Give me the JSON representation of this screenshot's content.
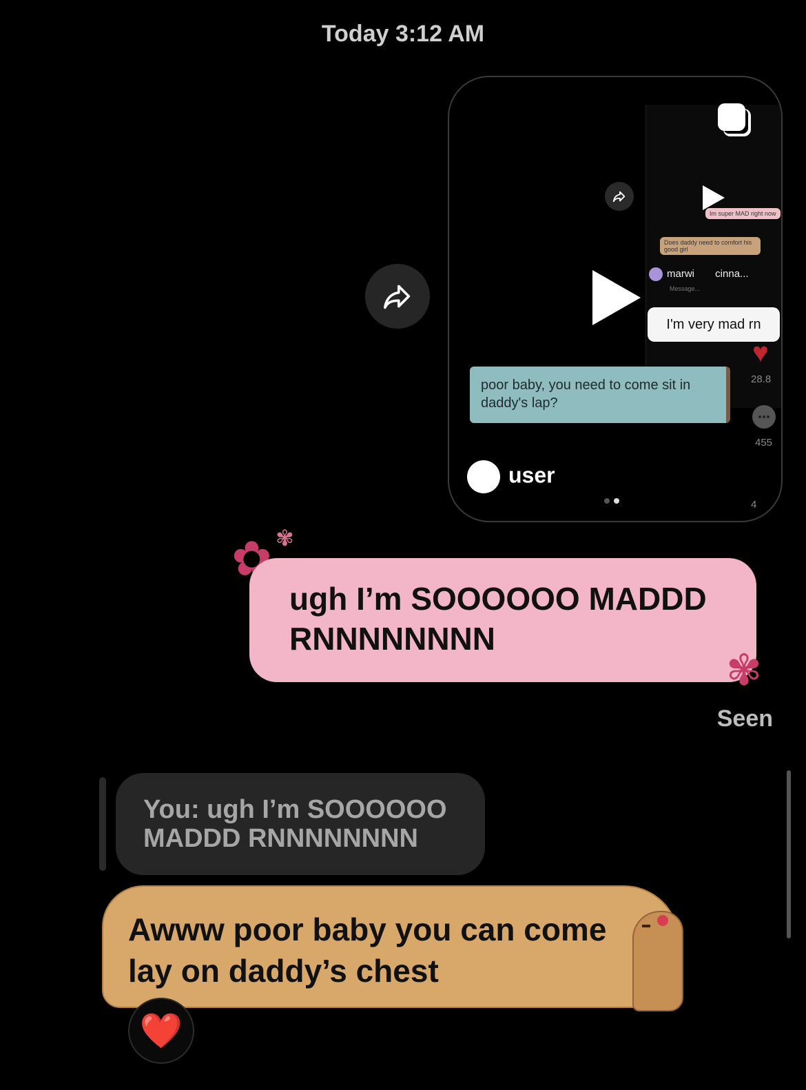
{
  "header": {
    "timestamp": "Today 3:12 AM"
  },
  "reel": {
    "username": "user",
    "mini_bubble_1": "Does daddy need to comfort his good girl",
    "mini_bubble_2": "Im super MAD right now",
    "users_row": "marwi",
    "users_row_2": "cinna...",
    "message_hint": "Message...",
    "mad_bubble": "I'm very mad rn",
    "poor_bubble": "poor baby, you need to come sit in daddy's lap?",
    "likes": "28.8",
    "comments": "455",
    "shares": "4"
  },
  "sent_message": {
    "text": "ugh I’m SOOOOOO MADDD RNNNNNNNN",
    "status": "Seen"
  },
  "reply_quote": {
    "text": "You: ugh I’m SOOOOOO MADDD RNNNNNNNN"
  },
  "received_message": {
    "text": "Awww poor baby you can come lay on daddy’s chest",
    "reaction": "❤️"
  },
  "icons": {
    "share": "share-arrow-icon",
    "play": "play-icon",
    "heart": "heart-icon",
    "flower": "flower-icon"
  }
}
